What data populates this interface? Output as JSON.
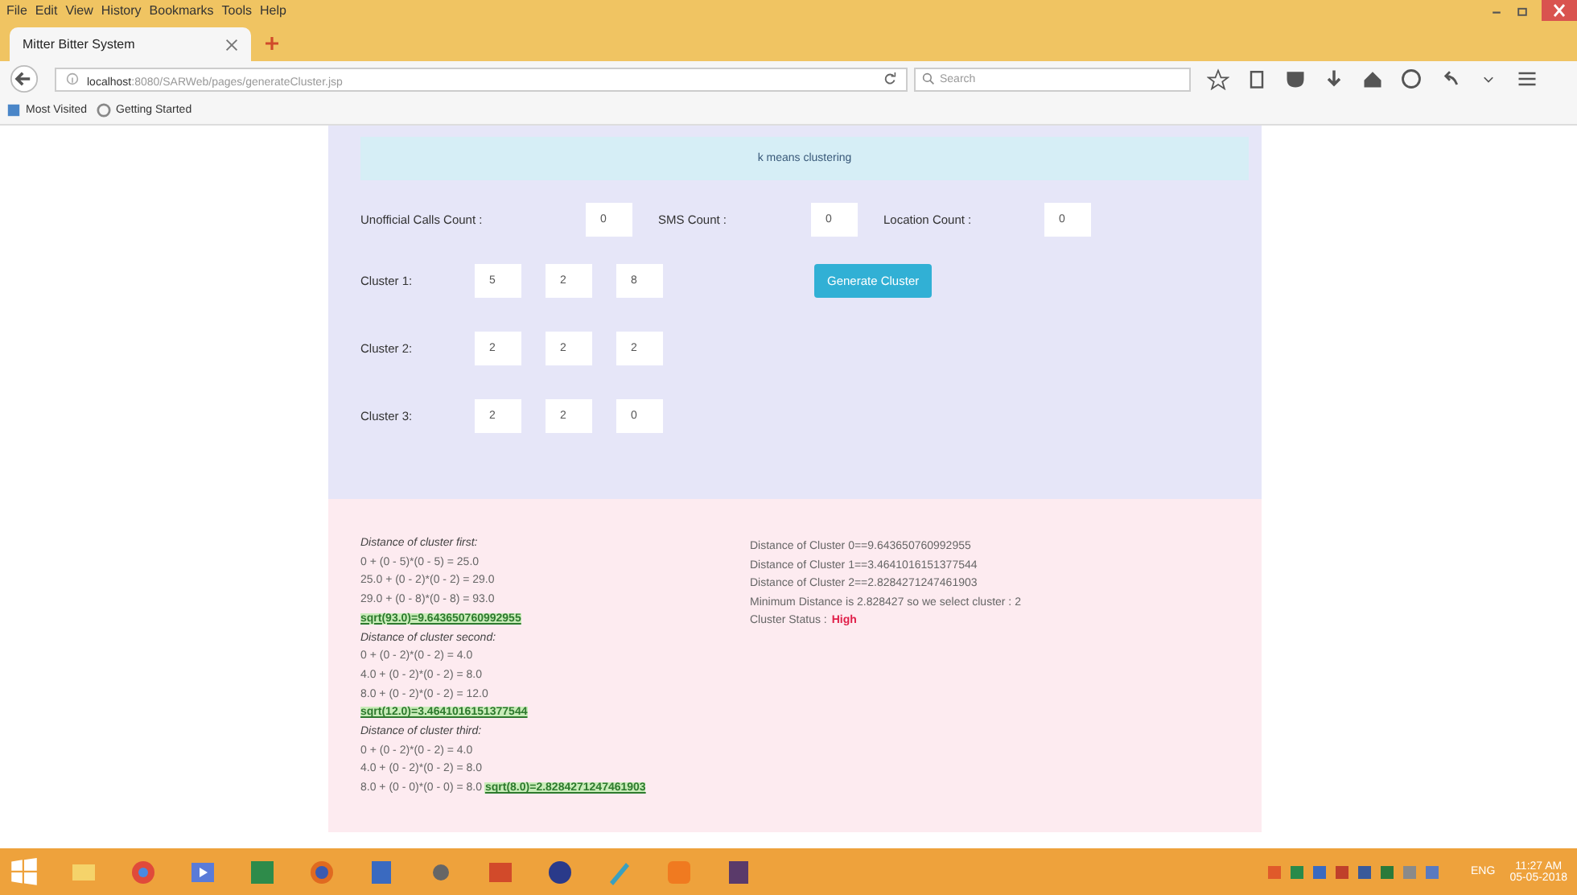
{
  "menu": [
    "File",
    "Edit",
    "View",
    "History",
    "Bookmarks",
    "Tools",
    "Help"
  ],
  "tab": {
    "title": "Mitter Bitter System",
    "selected": true
  },
  "address": {
    "host": "localhost",
    "path": ":8080/SARWeb/pages/generateCluster.jsp"
  },
  "search": {
    "placeholder": "Search"
  },
  "bookmarks": [
    "Most Visited",
    "Getting Started"
  ],
  "form": {
    "header": "k means clustering",
    "counts": [
      {
        "label": "Unofficial Calls Count :",
        "value": "0"
      },
      {
        "label": "SMS Count :",
        "value": "0"
      },
      {
        "label": "Location Count :",
        "value": "0"
      }
    ],
    "clusters": [
      {
        "label": "Cluster 1:",
        "values": [
          "5",
          "2",
          "8"
        ]
      },
      {
        "label": "Cluster 2:",
        "values": [
          "2",
          "2",
          "2"
        ]
      },
      {
        "label": "Cluster 3:",
        "values": [
          "2",
          "2",
          "0"
        ]
      }
    ],
    "button": "Generate Cluster"
  },
  "calc": [
    {
      "kind": "heading",
      "text": "Distance of cluster first:"
    },
    {
      "kind": "step",
      "text": "0 + (0 - 5)*(0 - 5) = 25.0"
    },
    {
      "kind": "step",
      "text": "25.0 + (0 - 2)*(0 - 2) = 29.0"
    },
    {
      "kind": "step",
      "text": "29.0 + (0 - 8)*(0 - 8) = 93.0"
    },
    {
      "kind": "result",
      "text": "sqrt(93.0)=9.643650760992955"
    },
    {
      "kind": "heading",
      "text": "Distance of cluster second:"
    },
    {
      "kind": "step",
      "text": "0 + (0 - 2)*(0 - 2) = 4.0"
    },
    {
      "kind": "step",
      "text": "4.0 + (0 - 2)*(0 - 2) = 8.0"
    },
    {
      "kind": "step",
      "text": "8.0 + (0 - 2)*(0 - 2) = 12.0"
    },
    {
      "kind": "result",
      "text": "sqrt(12.0)=3.4641016151377544"
    },
    {
      "kind": "heading",
      "text": "Distance of cluster third:"
    },
    {
      "kind": "step",
      "text": "0 + (0 - 2)*(0 - 2) = 4.0"
    },
    {
      "kind": "step",
      "text": "4.0 + (0 - 2)*(0 - 2) = 8.0"
    },
    {
      "kind": "step_result",
      "text": "8.0 + (0 - 0)*(0 - 0) = 8.0",
      "result": "sqrt(8.0)=2.8284271247461903"
    }
  ],
  "results": [
    "Distance of Cluster 0==9.643650760992955",
    "Distance of Cluster 1==3.4641016151377544",
    "Distance of Cluster 2==2.8284271247461903",
    "Minimum Distance is 2.828427 so we select cluster : 2"
  ],
  "status": {
    "label": "Cluster Status :",
    "value": "High"
  },
  "tray": {
    "lang": "ENG",
    "time": "11:27 AM",
    "date": "05-05-2018"
  }
}
